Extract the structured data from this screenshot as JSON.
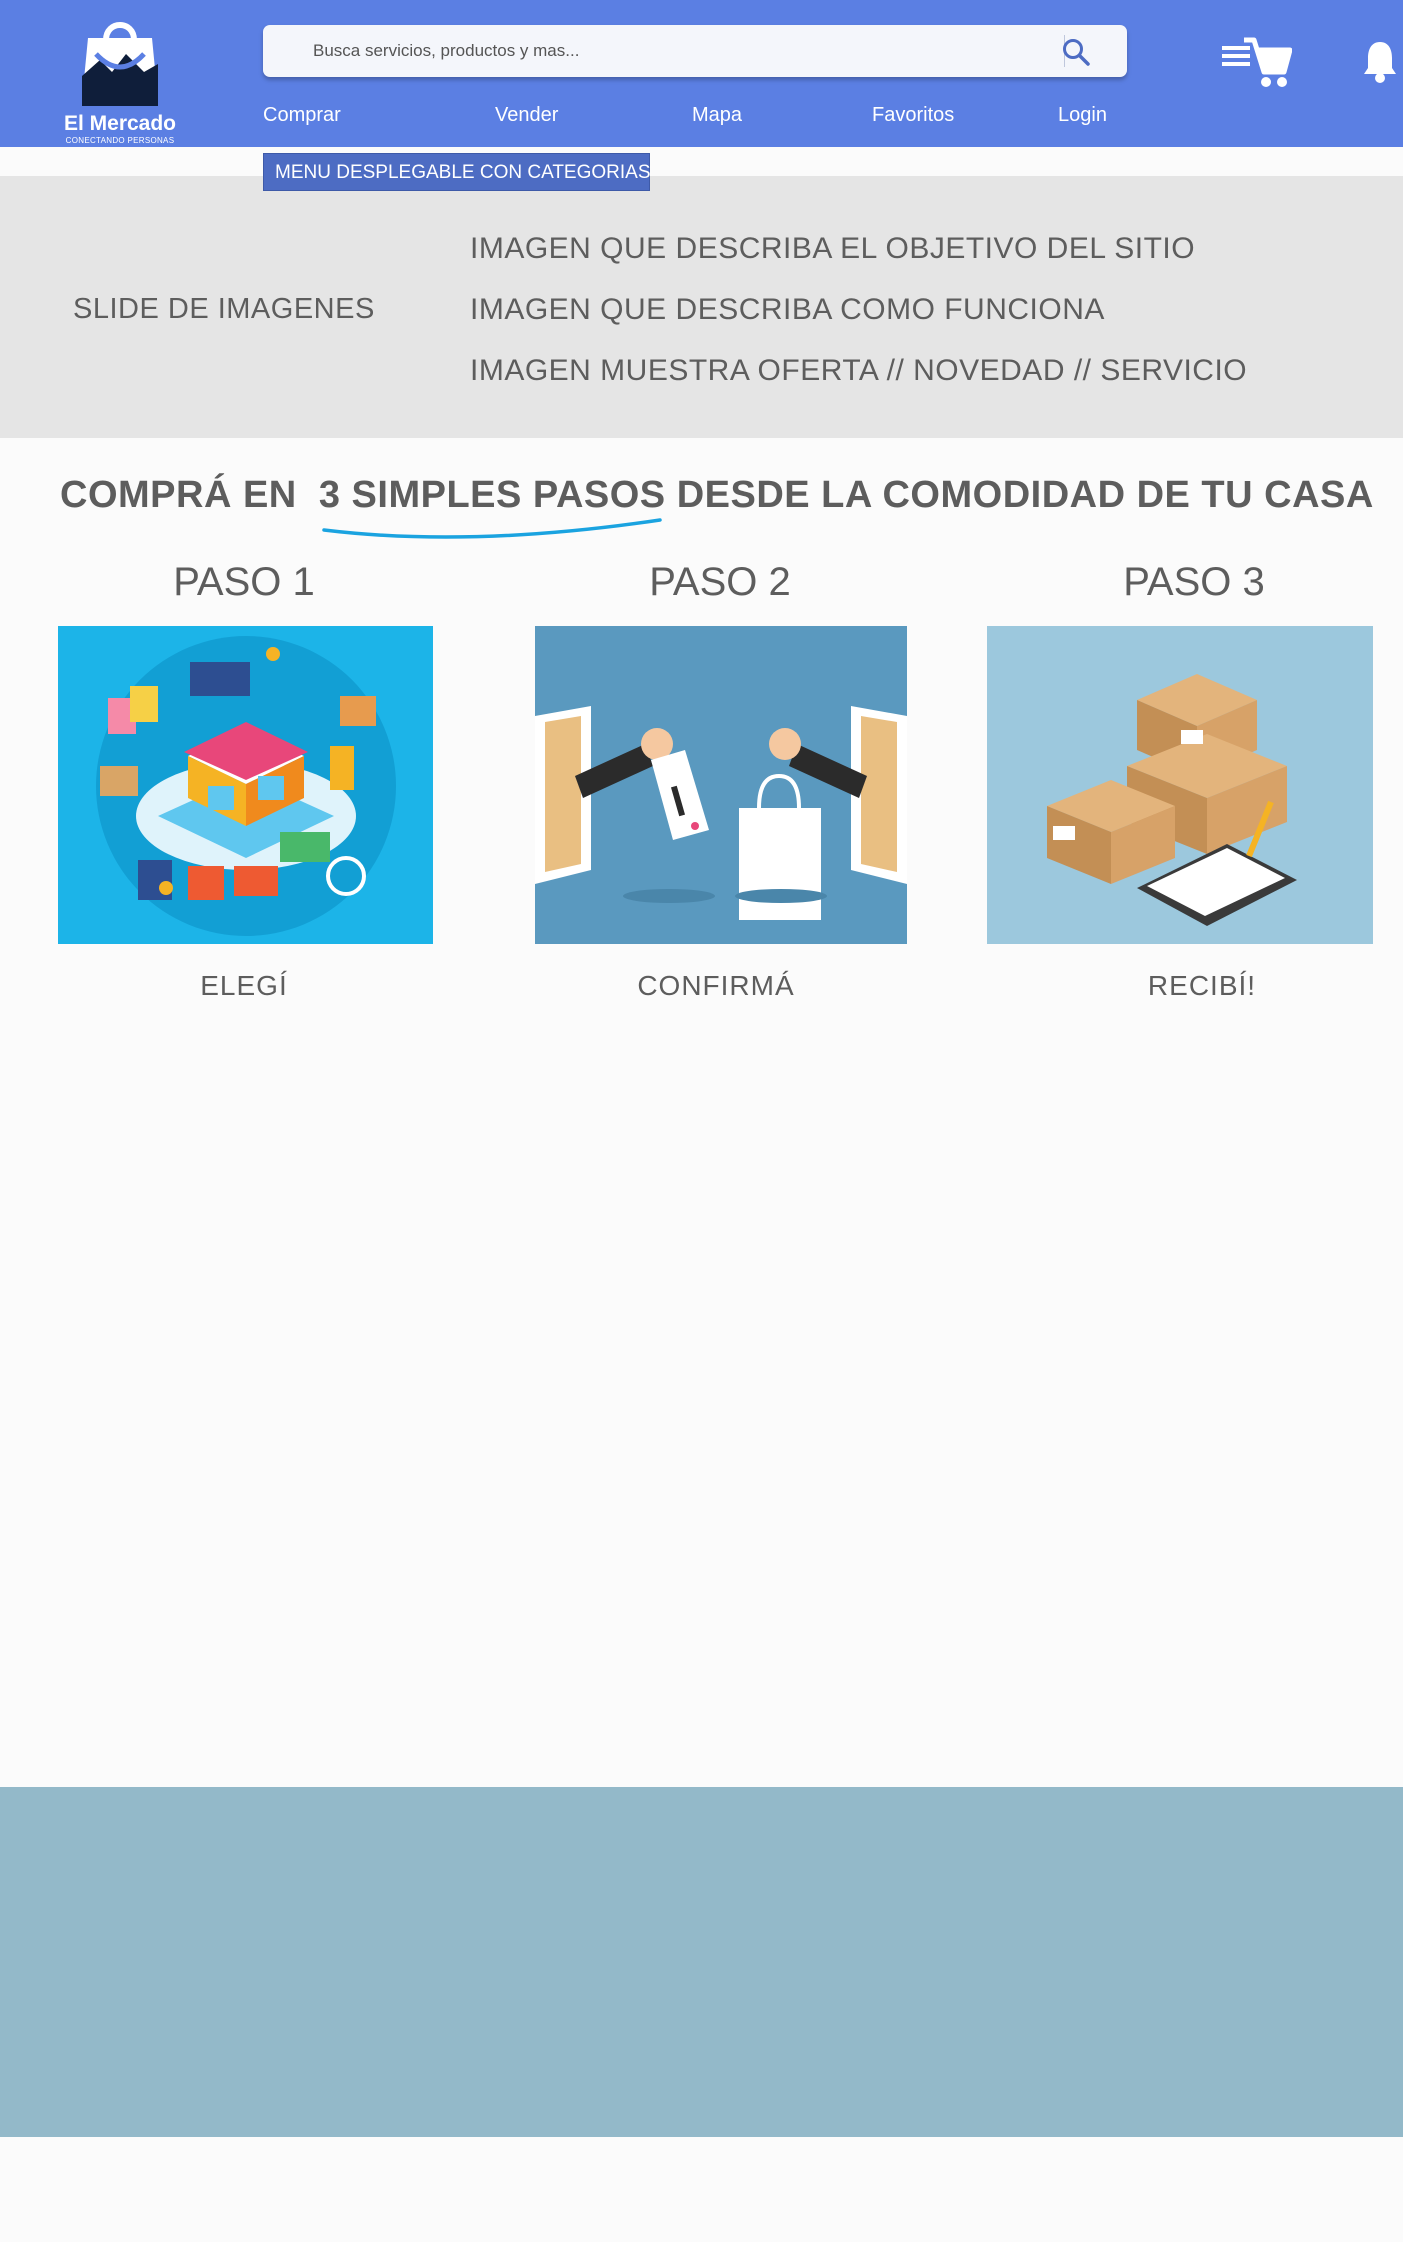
{
  "brand": {
    "name": "El Mercado",
    "tagline": "CONECTANDO PERSONAS"
  },
  "search": {
    "placeholder": "Busca servicios, productos y mas..."
  },
  "nav": {
    "items": [
      {
        "label": "Comprar"
      },
      {
        "label": "Vender"
      },
      {
        "label": "Mapa"
      },
      {
        "label": "Favoritos"
      },
      {
        "label": "Login"
      }
    ]
  },
  "categories_menu": {
    "label": "MENU DESPLEGABLE CON CATEGORIAS"
  },
  "hero": {
    "slider_label": "SLIDE DE IMAGENES",
    "lines": [
      "IMAGEN QUE DESCRIBA EL OBJETIVO DEL SITIO",
      "IMAGEN QUE DESCRIBA COMO FUNCIONA",
      "IMAGEN MUESTRA OFERTA // NOVEDAD // SERVICIO"
    ]
  },
  "steps_section": {
    "title_pre": "COMPRÁ EN",
    "title_highlight": "3 SIMPLES PASOS",
    "title_post": "DESDE LA COMODIDAD DE TU CASA",
    "steps": [
      {
        "title": "PASO 1",
        "label": "ELEGÍ"
      },
      {
        "title": "PASO 2",
        "label": "CONFIRMÁ"
      },
      {
        "title": "PASO 3",
        "label": "RECIBÍ!"
      }
    ]
  },
  "colors": {
    "header": "#5b7fe3",
    "menu": "#4d6cc3",
    "hero_bg": "#e5e5e5",
    "underline": "#1aa3e0",
    "footer": "#93b9c9"
  },
  "icons": [
    "bag-logo-icon",
    "search-icon",
    "cart-icon",
    "bell-icon"
  ]
}
